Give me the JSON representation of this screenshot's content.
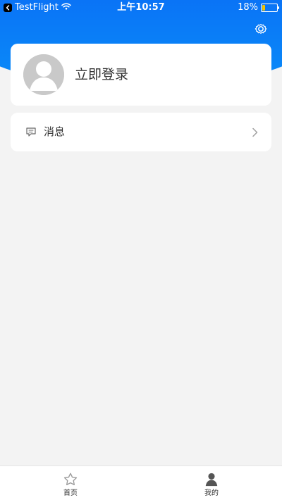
{
  "status_bar": {
    "carrier": "TestFlight",
    "time": "上午10:57",
    "battery_percent": "18%",
    "battery_level": 0.18,
    "battery_color": "#f5c400"
  },
  "header": {
    "settings_icon": "gear-icon",
    "accent": "#0a7cf7"
  },
  "profile": {
    "login_label": "立即登录",
    "avatar_icon": "user-avatar-icon"
  },
  "menu": {
    "items": [
      {
        "label": "消息",
        "icon": "message-icon",
        "chevron": "chevron-right-icon"
      }
    ]
  },
  "bottom_nav": {
    "items": [
      {
        "label": "首页",
        "icon": "star-icon"
      },
      {
        "label": "我的",
        "icon": "user-icon"
      }
    ]
  }
}
